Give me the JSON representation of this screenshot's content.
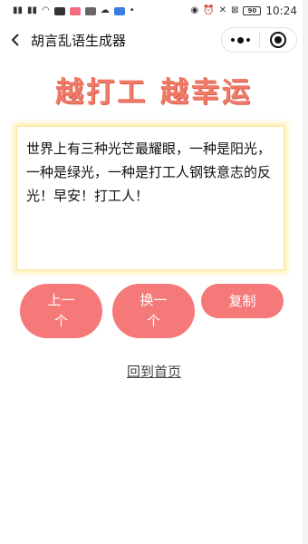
{
  "status_bar": {
    "left_icons": [
      "signal-icon",
      "signal-icon",
      "wifi-icon",
      "app-icon",
      "app-icon",
      "app-icon",
      "cloud-icon",
      "shield-icon",
      "dot-icon"
    ],
    "right_icons": [
      "eye-icon",
      "alarm-icon",
      "mute-icon",
      "close-icon"
    ],
    "battery": "90",
    "time": "10:24"
  },
  "nav": {
    "title": "胡言乱语生成器"
  },
  "banner": {
    "text": "越打工 越幸运"
  },
  "content": {
    "text": "世界上有三种光芒最耀眼，一种是阳光，一种是绿光，一种是打工人钢铁意志的反光！早安！打工人！"
  },
  "buttons": {
    "prev": "上一个",
    "next": "换一个",
    "copy": "复制"
  },
  "links": {
    "home": "回到首页"
  },
  "colors": {
    "accent": "#f57979",
    "banner": "#f07a68",
    "glow": "#ffe478"
  }
}
